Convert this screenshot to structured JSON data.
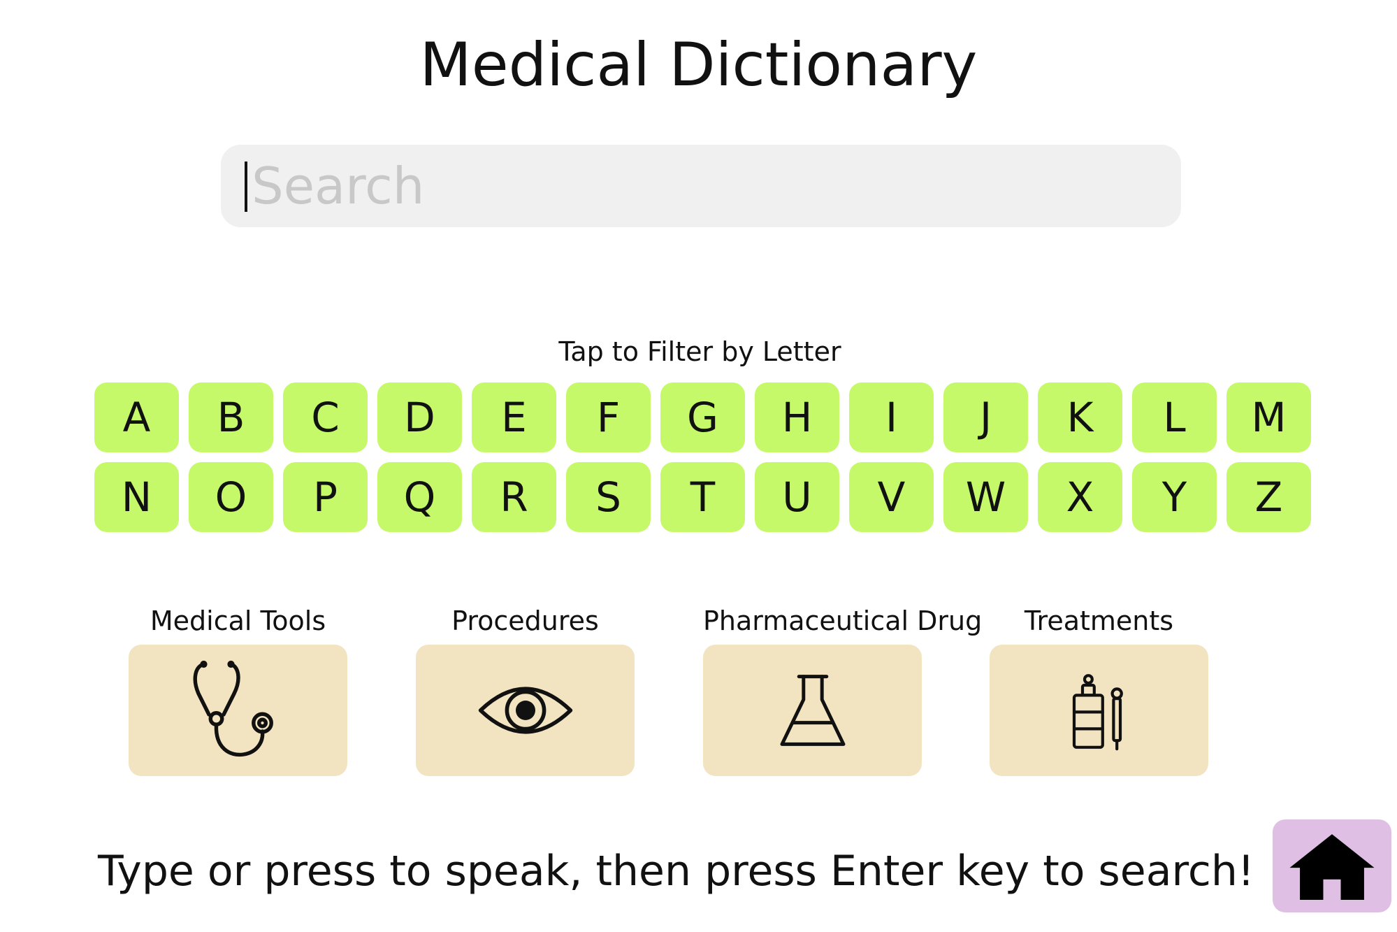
{
  "title": "Medical Dictionary",
  "search": {
    "placeholder": "Search",
    "value": ""
  },
  "filter": {
    "caption": "Tap to Filter by Letter",
    "letters": [
      "A",
      "B",
      "C",
      "D",
      "E",
      "F",
      "G",
      "H",
      "I",
      "J",
      "K",
      "L",
      "M",
      "N",
      "O",
      "P",
      "Q",
      "R",
      "S",
      "T",
      "U",
      "V",
      "W",
      "X",
      "Y",
      "Z"
    ]
  },
  "categories": [
    {
      "label": "Medical Tools",
      "icon": "stethoscope-icon"
    },
    {
      "label": "Procedures",
      "icon": "eye-icon"
    },
    {
      "label": "Pharmaceutical Drug",
      "icon": "flask-icon"
    },
    {
      "label": "Treatments",
      "icon": "medicine-bottle-icon"
    }
  ],
  "hint": "Type or press to speak, then press Enter key to search!",
  "home": {
    "icon": "home-icon"
  },
  "colors": {
    "letter_button": "#c6f96a",
    "category_card": "#f2e3c1",
    "home_button": "#dfc0e4",
    "search_background": "#f0f0f0"
  }
}
